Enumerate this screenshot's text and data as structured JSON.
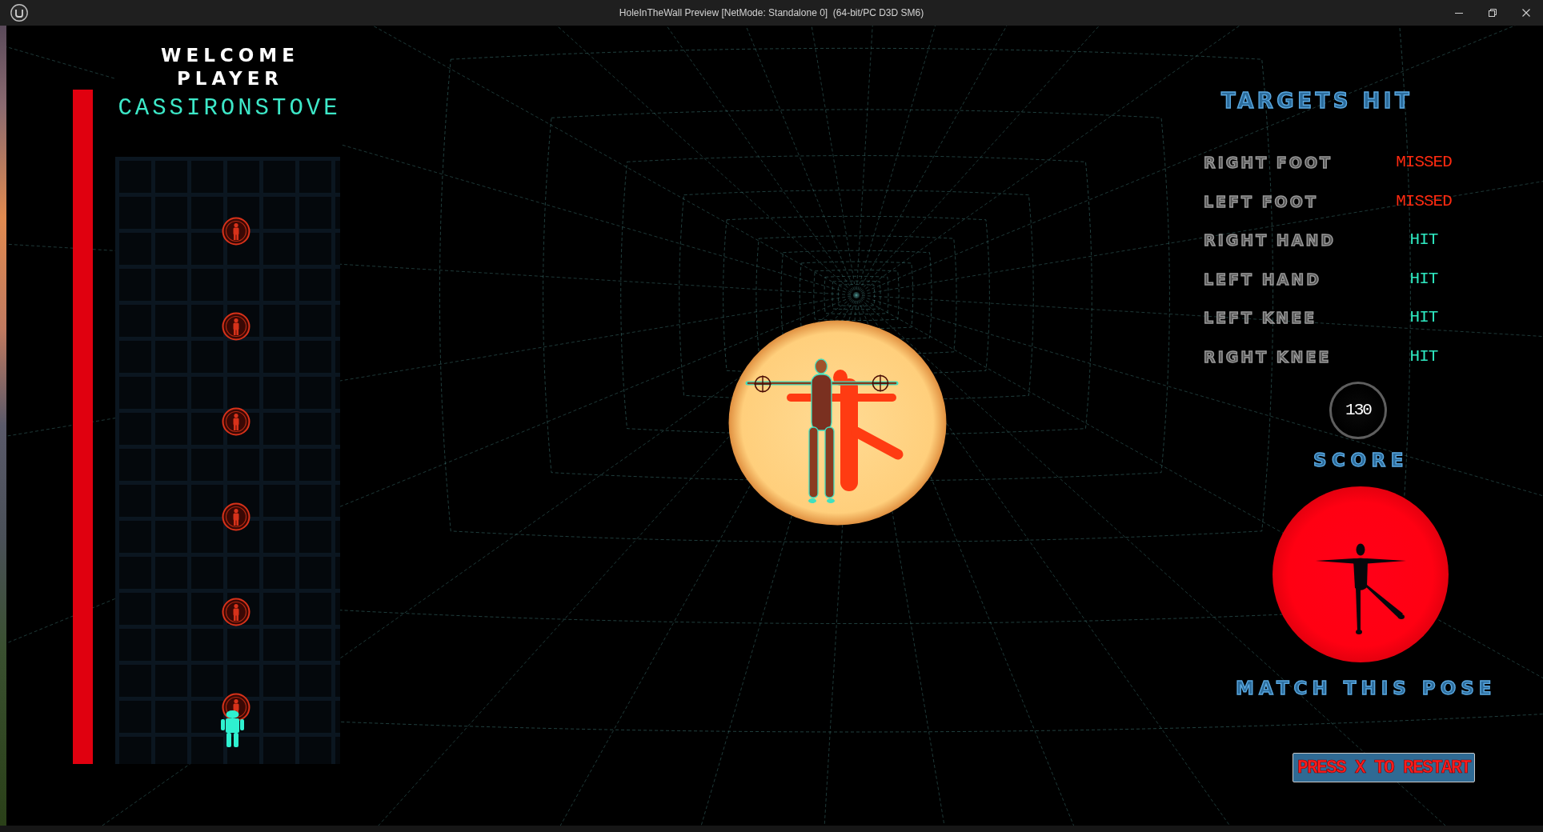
{
  "window": {
    "title": "HoleInTheWall Preview [NetMode: Standalone 0]  (64-bit/PC D3D SM6)"
  },
  "welcome": {
    "heading_lines": [
      "WELCOME",
      "PLAYER"
    ],
    "player_name": "CASSIRONSTOVE"
  },
  "targets_panel": {
    "title": "TARGETS HIT",
    "rows": [
      {
        "label": "RIGHT FOOT",
        "status": "MISSED",
        "hit": false
      },
      {
        "label": "LEFT FOOT",
        "status": "MISSED",
        "hit": false
      },
      {
        "label": "RIGHT HAND",
        "status": "HIT",
        "hit": true
      },
      {
        "label": "LEFT HAND",
        "status": "HIT",
        "hit": true
      },
      {
        "label": "LEFT KNEE",
        "status": "HIT",
        "hit": true
      },
      {
        "label": "RIGHT KNEE",
        "status": "HIT",
        "hit": true
      }
    ]
  },
  "score": {
    "value": "130",
    "label": "SCORE"
  },
  "pose_prompt": {
    "caption": "MATCH THIS POSE"
  },
  "restart_prompt": {
    "label": "PRESS X TO RESTART"
  }
}
